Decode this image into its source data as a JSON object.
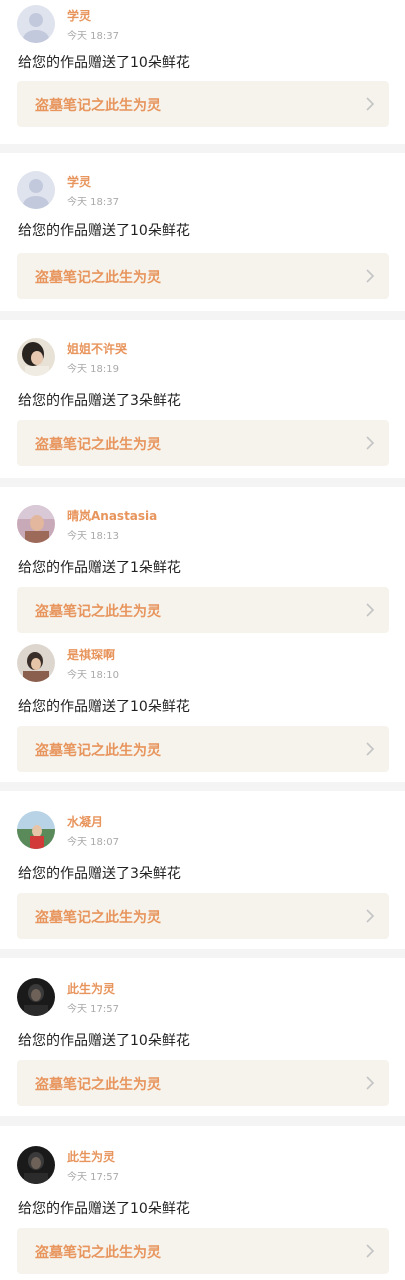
{
  "colors": {
    "page_bg": "#f4f4f4",
    "card_bg": "#ffffff",
    "accent": "#e8955d",
    "link_bg": "#f5f3ec",
    "time_gray": "#a9a9a9"
  },
  "feed": {
    "items": [
      {
        "name": "学灵",
        "time": "今天 18:37",
        "message": "给您的作品赠送了10朵鲜花",
        "work_title": "盗墓笔记之此生为灵",
        "avatar": "default-avatar"
      },
      {
        "name": "学灵",
        "time": "今天 18:37",
        "message": "给您的作品赠送了10朵鲜花",
        "work_title": "盗墓笔记之此生为灵",
        "avatar": "default-avatar"
      },
      {
        "name": "姐姐不许哭",
        "time": "今天 18:19",
        "message": "给您的作品赠送了3朵鲜花",
        "work_title": "盗墓笔记之此生为灵",
        "avatar": "photo-avatar"
      },
      {
        "name": "晴岚Anastasia",
        "time": "今天 18:13",
        "message": "给您的作品赠送了1朵鲜花",
        "work_title": "盗墓笔记之此生为灵",
        "avatar": "photo-avatar"
      },
      {
        "name": "是祺琛啊",
        "time": "今天 18:10",
        "message": "给您的作品赠送了10朵鲜花",
        "work_title": "盗墓笔记之此生为灵",
        "avatar": "photo-avatar"
      },
      {
        "name": "水凝月",
        "time": "今天 18:07",
        "message": "给您的作品赠送了3朵鲜花",
        "work_title": "盗墓笔记之此生为灵",
        "avatar": "photo-avatar"
      },
      {
        "name": "此生为灵",
        "time": "今天 17:57",
        "message": "给您的作品赠送了10朵鲜花",
        "work_title": "盗墓笔记之此生为灵",
        "avatar": "photo-avatar"
      },
      {
        "name": "此生为灵",
        "time": "今天 17:57",
        "message": "给您的作品赠送了10朵鲜花",
        "work_title": "盗墓笔记之此生为灵",
        "avatar": "photo-avatar"
      }
    ]
  }
}
